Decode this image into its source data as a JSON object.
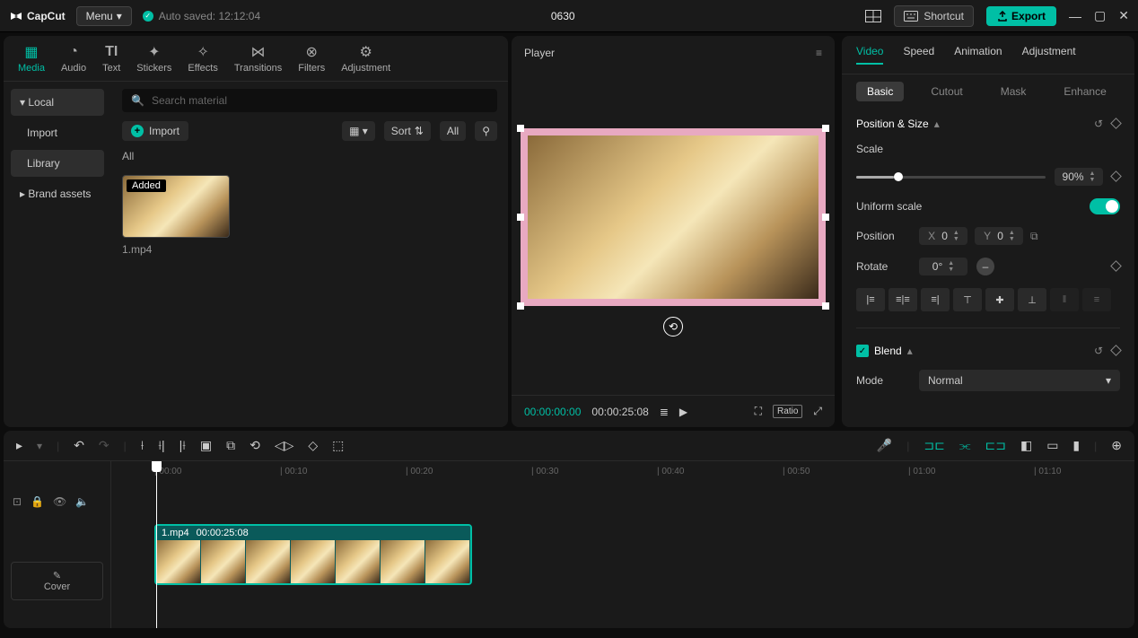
{
  "topbar": {
    "app_name": "CapCut",
    "menu_label": "Menu",
    "autosave": "Auto saved: 12:12:04",
    "project_title": "0630",
    "shortcut_label": "Shortcut",
    "export_label": "Export"
  },
  "media_tabs": {
    "media": "Media",
    "audio": "Audio",
    "text": "Text",
    "stickers": "Stickers",
    "effects": "Effects",
    "transitions": "Transitions",
    "filters": "Filters",
    "adjustment": "Adjustment"
  },
  "media_side": {
    "local": "Local",
    "import": "Import",
    "library": "Library",
    "brand": "Brand assets"
  },
  "media_main": {
    "search_placeholder": "Search material",
    "import_btn": "Import",
    "sort_label": "Sort",
    "all_label": "All",
    "group_all": "All",
    "added_tag": "Added",
    "clip_name": "1.mp4"
  },
  "player": {
    "title": "Player",
    "time_current": "00:00:00:00",
    "time_duration": "00:00:25:08",
    "ratio": "Ratio"
  },
  "inspector": {
    "tabs": {
      "video": "Video",
      "speed": "Speed",
      "animation": "Animation",
      "adjustment": "Adjustment"
    },
    "subtabs": {
      "basic": "Basic",
      "cutout": "Cutout",
      "mask": "Mask",
      "enhance": "Enhance"
    },
    "position_size": "Position & Size",
    "scale_label": "Scale",
    "scale_value": "90%",
    "uniform_scale": "Uniform scale",
    "position_label": "Position",
    "pos_x": "0",
    "pos_y": "0",
    "rotate_label": "Rotate",
    "rotate_value": "0°",
    "blend_label": "Blend",
    "mode_label": "Mode",
    "mode_value": "Normal"
  },
  "timeline": {
    "cover_label": "Cover",
    "clip_name": "1.mp4",
    "clip_dur": "00:00:25:08",
    "ticks": [
      "00:00",
      "00:10",
      "00:20",
      "00:30",
      "00:40",
      "00:50",
      "01:00",
      "01:10"
    ]
  }
}
